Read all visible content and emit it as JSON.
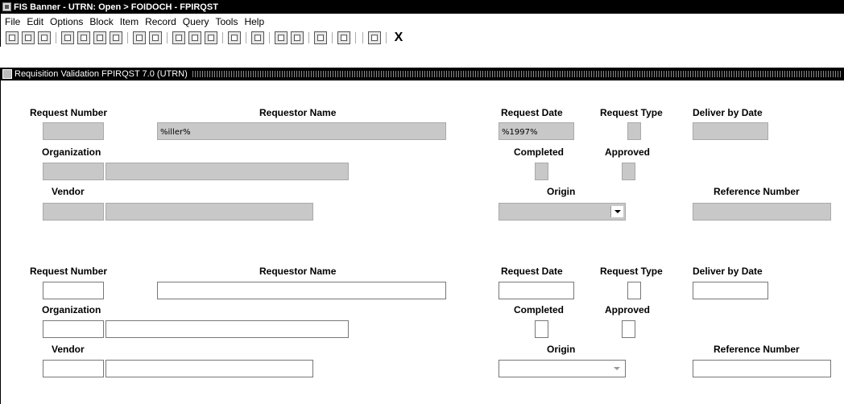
{
  "window": {
    "title": "FIS Banner - UTRN: Open > FOIDOCH - FPIRQST"
  },
  "menu": [
    "File",
    "Edit",
    "Options",
    "Block",
    "Item",
    "Record",
    "Query",
    "Tools",
    "Help"
  ],
  "toolbar": {
    "icons": [
      "save-icon",
      "rollback-icon",
      "document-icon",
      "insert-record-icon",
      "remove-record-icon",
      "enter-query-icon",
      "execute-query-icon",
      "previous-block-icon",
      "next-block-icon",
      "options-icon",
      "list-icon",
      "cancel-query-icon",
      "print-icon",
      "print-preview-icon",
      "export-icon",
      "cut-icon",
      "copy-icon",
      "paste-icon",
      "help-icon",
      "exit-icon"
    ],
    "exit_label": "X"
  },
  "form": {
    "title": "Requisition Validation FPIRQST 7.0 (UTRN)"
  },
  "labels": {
    "request_number": "Request Number",
    "requestor_name": "Requestor Name",
    "request_date": "Request Date",
    "request_type": "Request Type",
    "deliver_by_date": "Deliver by Date",
    "organization": "Organization",
    "completed": "Completed",
    "approved": "Approved",
    "vendor": "Vendor",
    "origin": "Origin",
    "reference_number": "Reference Number"
  },
  "query_block": {
    "request_number": "",
    "requestor_name": "%iller%",
    "request_date": "%1997%",
    "request_type": "",
    "deliver_by_date": "",
    "organization_code": "",
    "organization_name": "",
    "vendor_id": "",
    "vendor_name": "",
    "origin": "",
    "reference_number": ""
  },
  "record_block": {
    "request_number": "",
    "requestor_name": "",
    "request_date": "",
    "request_type": "",
    "deliver_by_date": "",
    "organization_code": "",
    "organization_name": "",
    "vendor_id": "",
    "vendor_name": "",
    "origin": "",
    "reference_number": ""
  }
}
